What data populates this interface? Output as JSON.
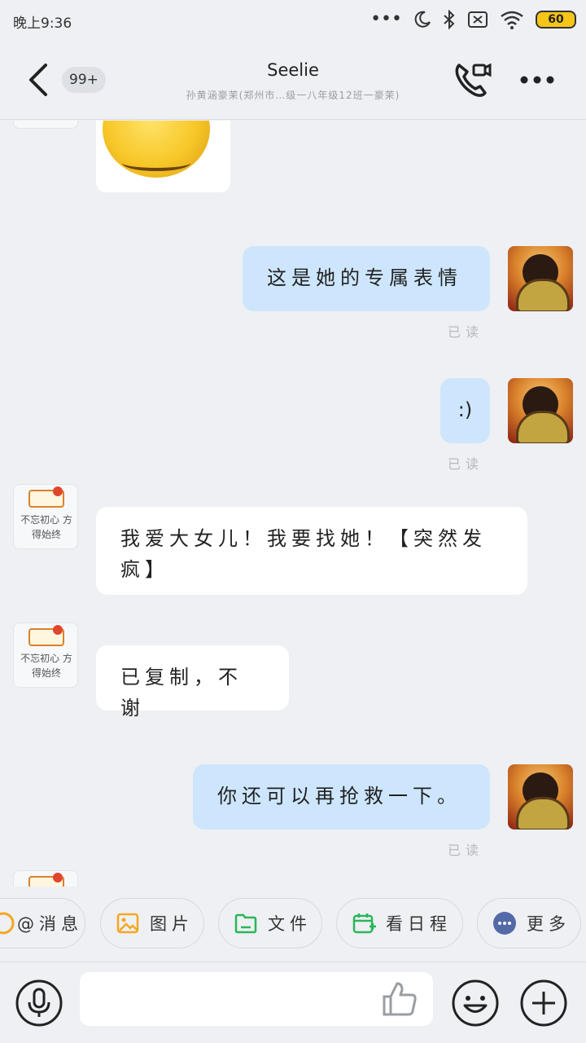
{
  "status_bar": {
    "time": "晚上9:36",
    "battery": "60"
  },
  "header": {
    "unread_badge": "99+",
    "title": "Seelie",
    "subtitle": "孙黄涵豪茉(郑州市…级一八年级12班一豪茉)"
  },
  "messages": [
    {
      "sender": "self",
      "text": "这是她的专属表情",
      "read": "已读"
    },
    {
      "sender": "self",
      "text": ":)",
      "read": "已读"
    },
    {
      "sender": "other",
      "text": "我爱大女儿！我要找她！【突然发疯】"
    },
    {
      "sender": "other",
      "text": "已复制，不谢"
    },
    {
      "sender": "self",
      "text": "你还可以再抢救一下。",
      "read": "已读"
    }
  ],
  "avatars": {
    "other_caption": "不忘初心 方得始终"
  },
  "quick_actions": [
    {
      "label": "@消息",
      "icon": "at-icon"
    },
    {
      "label": "图片",
      "icon": "image-icon"
    },
    {
      "label": "文件",
      "icon": "folder-icon"
    },
    {
      "label": "看日程",
      "icon": "calendar-icon"
    },
    {
      "label": "更多",
      "icon": "more-icon"
    }
  ],
  "input": {
    "placeholder": ""
  },
  "colors": {
    "self_bubble": "#cde6fd",
    "other_bubble": "#ffffff",
    "background": "#eef0f3",
    "accent_orange": "#f5a623",
    "accent_green": "#2bb55a",
    "accent_blue": "#5469a8"
  }
}
